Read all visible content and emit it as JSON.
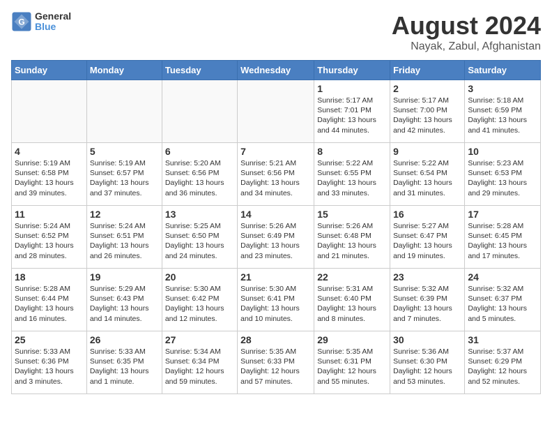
{
  "logo": {
    "general": "General",
    "blue": "Blue"
  },
  "title": "August 2024",
  "subtitle": "Nayak, Zabul, Afghanistan",
  "weekdays": [
    "Sunday",
    "Monday",
    "Tuesday",
    "Wednesday",
    "Thursday",
    "Friday",
    "Saturday"
  ],
  "weeks": [
    [
      {
        "date": "",
        "text": ""
      },
      {
        "date": "",
        "text": ""
      },
      {
        "date": "",
        "text": ""
      },
      {
        "date": "",
        "text": ""
      },
      {
        "date": "1",
        "text": "Sunrise: 5:17 AM\nSunset: 7:01 PM\nDaylight: 13 hours\nand 44 minutes."
      },
      {
        "date": "2",
        "text": "Sunrise: 5:17 AM\nSunset: 7:00 PM\nDaylight: 13 hours\nand 42 minutes."
      },
      {
        "date": "3",
        "text": "Sunrise: 5:18 AM\nSunset: 6:59 PM\nDaylight: 13 hours\nand 41 minutes."
      }
    ],
    [
      {
        "date": "4",
        "text": "Sunrise: 5:19 AM\nSunset: 6:58 PM\nDaylight: 13 hours\nand 39 minutes."
      },
      {
        "date": "5",
        "text": "Sunrise: 5:19 AM\nSunset: 6:57 PM\nDaylight: 13 hours\nand 37 minutes."
      },
      {
        "date": "6",
        "text": "Sunrise: 5:20 AM\nSunset: 6:56 PM\nDaylight: 13 hours\nand 36 minutes."
      },
      {
        "date": "7",
        "text": "Sunrise: 5:21 AM\nSunset: 6:56 PM\nDaylight: 13 hours\nand 34 minutes."
      },
      {
        "date": "8",
        "text": "Sunrise: 5:22 AM\nSunset: 6:55 PM\nDaylight: 13 hours\nand 33 minutes."
      },
      {
        "date": "9",
        "text": "Sunrise: 5:22 AM\nSunset: 6:54 PM\nDaylight: 13 hours\nand 31 minutes."
      },
      {
        "date": "10",
        "text": "Sunrise: 5:23 AM\nSunset: 6:53 PM\nDaylight: 13 hours\nand 29 minutes."
      }
    ],
    [
      {
        "date": "11",
        "text": "Sunrise: 5:24 AM\nSunset: 6:52 PM\nDaylight: 13 hours\nand 28 minutes."
      },
      {
        "date": "12",
        "text": "Sunrise: 5:24 AM\nSunset: 6:51 PM\nDaylight: 13 hours\nand 26 minutes."
      },
      {
        "date": "13",
        "text": "Sunrise: 5:25 AM\nSunset: 6:50 PM\nDaylight: 13 hours\nand 24 minutes."
      },
      {
        "date": "14",
        "text": "Sunrise: 5:26 AM\nSunset: 6:49 PM\nDaylight: 13 hours\nand 23 minutes."
      },
      {
        "date": "15",
        "text": "Sunrise: 5:26 AM\nSunset: 6:48 PM\nDaylight: 13 hours\nand 21 minutes."
      },
      {
        "date": "16",
        "text": "Sunrise: 5:27 AM\nSunset: 6:47 PM\nDaylight: 13 hours\nand 19 minutes."
      },
      {
        "date": "17",
        "text": "Sunrise: 5:28 AM\nSunset: 6:45 PM\nDaylight: 13 hours\nand 17 minutes."
      }
    ],
    [
      {
        "date": "18",
        "text": "Sunrise: 5:28 AM\nSunset: 6:44 PM\nDaylight: 13 hours\nand 16 minutes."
      },
      {
        "date": "19",
        "text": "Sunrise: 5:29 AM\nSunset: 6:43 PM\nDaylight: 13 hours\nand 14 minutes."
      },
      {
        "date": "20",
        "text": "Sunrise: 5:30 AM\nSunset: 6:42 PM\nDaylight: 13 hours\nand 12 minutes."
      },
      {
        "date": "21",
        "text": "Sunrise: 5:30 AM\nSunset: 6:41 PM\nDaylight: 13 hours\nand 10 minutes."
      },
      {
        "date": "22",
        "text": "Sunrise: 5:31 AM\nSunset: 6:40 PM\nDaylight: 13 hours\nand 8 minutes."
      },
      {
        "date": "23",
        "text": "Sunrise: 5:32 AM\nSunset: 6:39 PM\nDaylight: 13 hours\nand 7 minutes."
      },
      {
        "date": "24",
        "text": "Sunrise: 5:32 AM\nSunset: 6:37 PM\nDaylight: 13 hours\nand 5 minutes."
      }
    ],
    [
      {
        "date": "25",
        "text": "Sunrise: 5:33 AM\nSunset: 6:36 PM\nDaylight: 13 hours\nand 3 minutes."
      },
      {
        "date": "26",
        "text": "Sunrise: 5:33 AM\nSunset: 6:35 PM\nDaylight: 13 hours\nand 1 minute."
      },
      {
        "date": "27",
        "text": "Sunrise: 5:34 AM\nSunset: 6:34 PM\nDaylight: 12 hours\nand 59 minutes."
      },
      {
        "date": "28",
        "text": "Sunrise: 5:35 AM\nSunset: 6:33 PM\nDaylight: 12 hours\nand 57 minutes."
      },
      {
        "date": "29",
        "text": "Sunrise: 5:35 AM\nSunset: 6:31 PM\nDaylight: 12 hours\nand 55 minutes."
      },
      {
        "date": "30",
        "text": "Sunrise: 5:36 AM\nSunset: 6:30 PM\nDaylight: 12 hours\nand 53 minutes."
      },
      {
        "date": "31",
        "text": "Sunrise: 5:37 AM\nSunset: 6:29 PM\nDaylight: 12 hours\nand 52 minutes."
      }
    ]
  ]
}
